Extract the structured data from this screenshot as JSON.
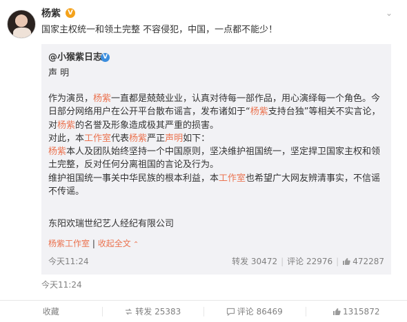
{
  "post": {
    "username": "杨紫",
    "verified_badge": "V",
    "text": "国家主权统一和领土完整 不容侵犯，中国，一点都不能少！",
    "outer_time": "今天11:24",
    "more_icon": "chevron-down-icon"
  },
  "repost": {
    "author": "@小猴紫日志",
    "verified_badge": "V",
    "title": "声 明",
    "p1_a": "作为演员，",
    "p1_hl1": "杨紫",
    "p1_b": "一直都是兢兢业业，认真对待每一部作品，用心演绎每一个角色。今日部分网络用户在公开平台散布谣言，发布诸如于“",
    "p1_hl2": "杨紫",
    "p1_c": "支持台独”等相关不实言论，对",
    "p1_hl3": "杨紫",
    "p1_d": "的名誉及形象造成极其严重的损害。",
    "p2_a": "对此，本",
    "p2_hl1": "工作室",
    "p2_b": "代表",
    "p2_hl2": "杨紫",
    "p2_c": "严正",
    "p2_hl3": "声明",
    "p2_d": "如下：",
    "p3_hl1": "杨紫",
    "p3_a": "本人及团队始终坚持一个中国原则，坚决维护祖国统一，坚定捍卫国家主权和领土完整，反对任何分离祖国的言论及行为。",
    "p4_a": "维护祖国统一事关中华民族的根本利益，本",
    "p4_hl1": "工作室",
    "p4_b": "也希望广大网友辨清事实，不信谣不传谣。",
    "company": "东阳欢瑞世纪艺人经纪有限公司",
    "sig_link": "杨紫工作室",
    "sig_sep": "|",
    "collapse": "收起全文",
    "time": "今天11:24",
    "repost_label": "转发 30472",
    "comment_label": "评论 22976",
    "like_count": "472287"
  },
  "actions": {
    "favorite": "收藏",
    "repost": "转发 25383",
    "comment": "评论 86469",
    "like": "1315872"
  },
  "colors": {
    "highlight": "#eb7350",
    "badge_orange": "#f4a21b",
    "badge_blue": "#3b8ddd",
    "repost_bg": "#f2f2f5"
  }
}
